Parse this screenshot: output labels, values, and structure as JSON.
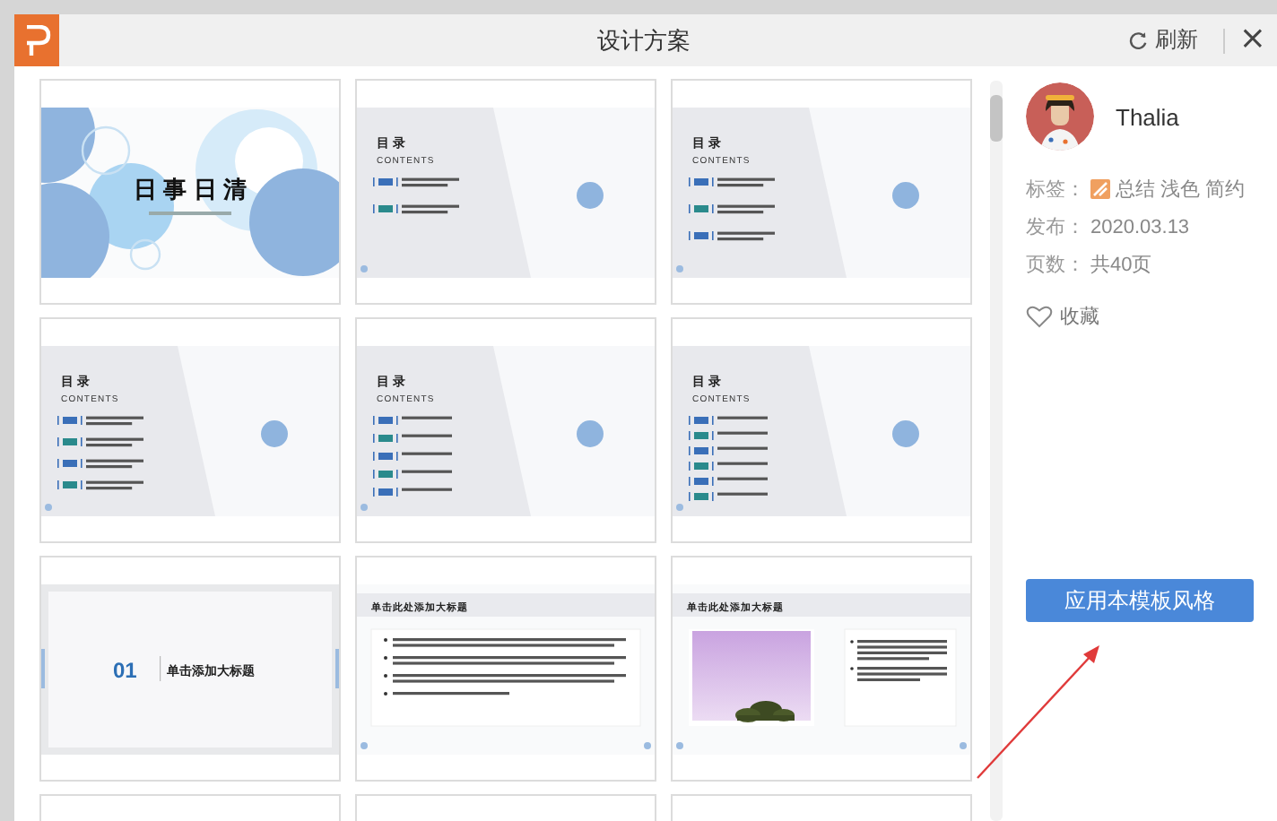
{
  "window": {
    "title": "设计方案",
    "refresh": "刷新",
    "close": "×"
  },
  "slides": [
    {
      "kind": "cover",
      "title": "日 事 日 清"
    },
    {
      "kind": "toc",
      "heading": "目 录",
      "subheading": "CONTENTS",
      "two_line": true,
      "entries": [
        {
          "color": "#3a6fb8"
        },
        {
          "color": "#2a8a8c"
        }
      ]
    },
    {
      "kind": "toc",
      "heading": "目 录",
      "subheading": "CONTENTS",
      "two_line": true,
      "entries": [
        {
          "color": "#3a6fb8"
        },
        {
          "color": "#2a8a8c"
        },
        {
          "color": "#3a6fb8"
        }
      ]
    },
    {
      "kind": "toc",
      "heading": "目 录",
      "subheading": "CONTENTS",
      "two_line": true,
      "entries": [
        {
          "color": "#3a6fb8"
        },
        {
          "color": "#2a8a8c"
        },
        {
          "color": "#3a6fb8"
        },
        {
          "color": "#2a8a8c"
        }
      ]
    },
    {
      "kind": "toc",
      "heading": "目 录",
      "subheading": "CONTENTS",
      "two_line": false,
      "entries": [
        {
          "color": "#3a6fb8"
        },
        {
          "color": "#2a8a8c"
        },
        {
          "color": "#3a6fb8"
        },
        {
          "color": "#2a8a8c"
        },
        {
          "color": "#3a6fb8"
        }
      ]
    },
    {
      "kind": "toc",
      "heading": "目 录",
      "subheading": "CONTENTS",
      "two_line": false,
      "entries": [
        {
          "color": "#3a6fb8"
        },
        {
          "color": "#2a8a8c"
        },
        {
          "color": "#3a6fb8"
        },
        {
          "color": "#2a8a8c"
        },
        {
          "color": "#3a6fb8"
        },
        {
          "color": "#2a8a8c"
        }
      ]
    },
    {
      "kind": "section",
      "number": "01",
      "title": "单击添加大标题"
    },
    {
      "kind": "bullets",
      "title": "单击此处添加大标题"
    },
    {
      "kind": "picture-text",
      "title": "单击此处添加大标题"
    },
    {
      "kind": "cut"
    },
    {
      "kind": "cut"
    },
    {
      "kind": "cut"
    }
  ],
  "author": {
    "name": "Thalia"
  },
  "details": [
    {
      "label": "标签：",
      "tags": [
        "总结",
        "浅色",
        "简约"
      ]
    },
    {
      "label": "发布：",
      "value": "2020.03.13"
    },
    {
      "label": "页数：",
      "value": "共40页"
    }
  ],
  "favorite": {
    "label": "收藏",
    "selected": false
  },
  "apply_button": "应用本模板风格"
}
